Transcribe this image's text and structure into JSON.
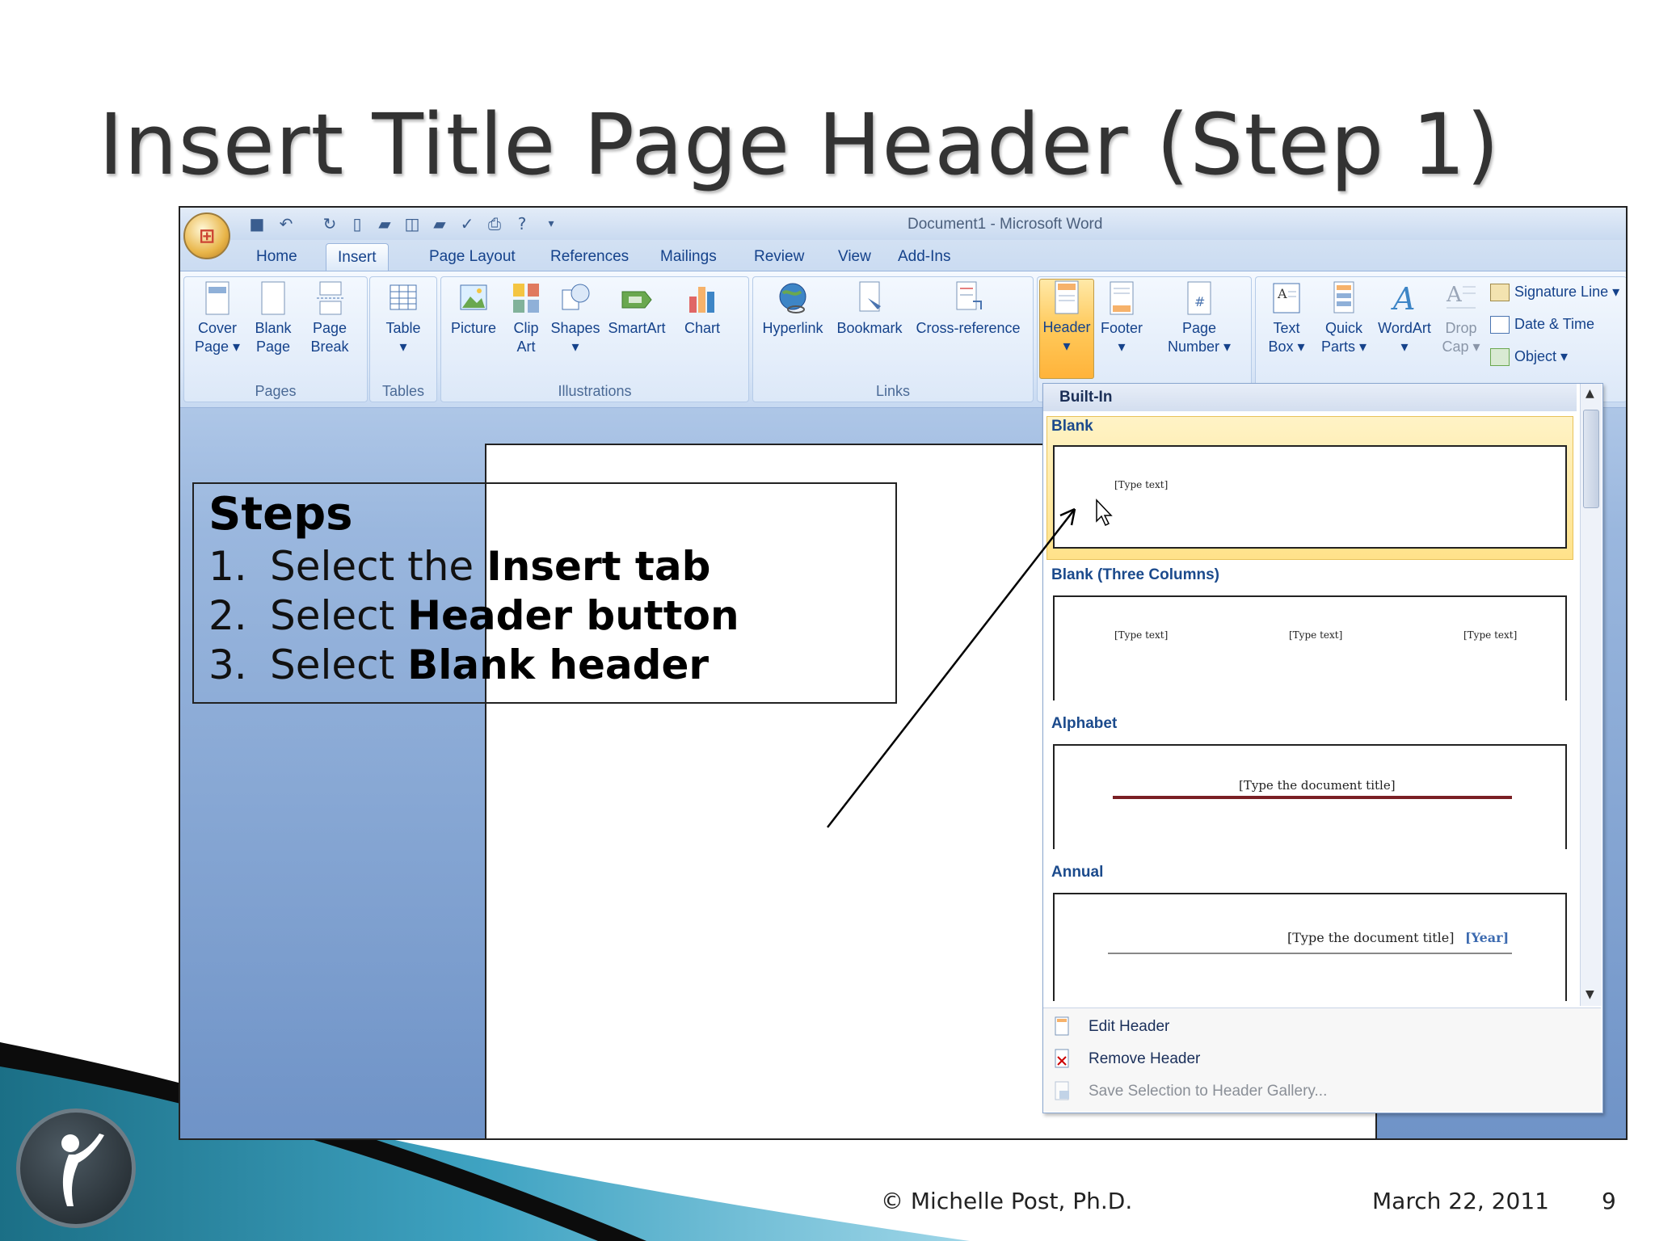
{
  "slide": {
    "title": "Insert Title Page Header (Step 1)",
    "footer_copyright": "© Michelle Post, Ph.D.",
    "footer_date": "March 22, 2011",
    "page_number": "9"
  },
  "word": {
    "window_title": "Document1 - Microsoft Word",
    "tabs": [
      {
        "label": "Home",
        "active": false
      },
      {
        "label": "Insert",
        "active": true
      },
      {
        "label": "Page Layout",
        "active": false
      },
      {
        "label": "References",
        "active": false
      },
      {
        "label": "Mailings",
        "active": false
      },
      {
        "label": "Review",
        "active": false
      },
      {
        "label": "View",
        "active": false
      },
      {
        "label": "Add-Ins",
        "active": false
      }
    ],
    "ribbon": {
      "pages": {
        "label": "Pages",
        "buttons": [
          {
            "line1": "Cover",
            "line2": "Page ▾"
          },
          {
            "line1": "Blank",
            "line2": "Page"
          },
          {
            "line1": "Page",
            "line2": "Break"
          }
        ]
      },
      "tables": {
        "label": "Tables",
        "buttons": [
          {
            "line1": "Table",
            "line2": "▾"
          }
        ]
      },
      "illustrations": {
        "label": "Illustrations",
        "buttons": [
          {
            "line1": "Picture",
            "line2": ""
          },
          {
            "line1": "Clip",
            "line2": "Art"
          },
          {
            "line1": "Shapes",
            "line2": "▾"
          },
          {
            "line1": "SmartArt",
            "line2": ""
          },
          {
            "line1": "Chart",
            "line2": ""
          }
        ]
      },
      "links": {
        "label": "Links",
        "buttons": [
          {
            "line1": "Hyperlink",
            "line2": ""
          },
          {
            "line1": "Bookmark",
            "line2": ""
          },
          {
            "line1": "Cross-reference",
            "line2": ""
          }
        ]
      },
      "header_footer": {
        "buttons": [
          {
            "line1": "Header",
            "line2": "▾"
          },
          {
            "line1": "Footer",
            "line2": "▾"
          },
          {
            "line1": "Page",
            "line2": "Number ▾"
          }
        ]
      },
      "text": {
        "buttons": [
          {
            "line1": "Text",
            "line2": "Box ▾"
          },
          {
            "line1": "Quick",
            "line2": "Parts ▾"
          },
          {
            "line1": "WordArt",
            "line2": "▾"
          },
          {
            "line1": "Drop",
            "line2": "Cap ▾"
          }
        ],
        "small": [
          "Signature Line ▾",
          "Date & Time",
          "Object ▾"
        ]
      }
    }
  },
  "steps": {
    "title": "Steps",
    "items": [
      {
        "num": "1.",
        "pre": "Select the ",
        "bold": "Insert tab"
      },
      {
        "num": "2.",
        "pre": "Select ",
        "bold": "Header button"
      },
      {
        "num": "3.",
        "pre": "Select ",
        "bold": "Blank header"
      }
    ]
  },
  "gallery": {
    "section": "Built-In",
    "items": [
      {
        "name": "Blank",
        "texts": [
          "[Type text]"
        ]
      },
      {
        "name": "Blank (Three Columns)",
        "texts": [
          "[Type text]",
          "[Type text]",
          "[Type text]"
        ]
      },
      {
        "name": "Alphabet",
        "texts": [
          "[Type the document title]"
        ]
      },
      {
        "name": "Annual",
        "texts": [
          "[Type the document title]",
          "[Year]"
        ]
      }
    ],
    "commands": [
      {
        "label": "Edit Header",
        "enabled": true
      },
      {
        "label": "Remove Header",
        "enabled": true
      },
      {
        "label": "Save Selection to Header Gallery...",
        "enabled": false
      }
    ]
  },
  "colors": {
    "accent_tab": "#15428b",
    "header_hover": "#ffc95a",
    "gallery_highlight": "#ffe28a"
  }
}
